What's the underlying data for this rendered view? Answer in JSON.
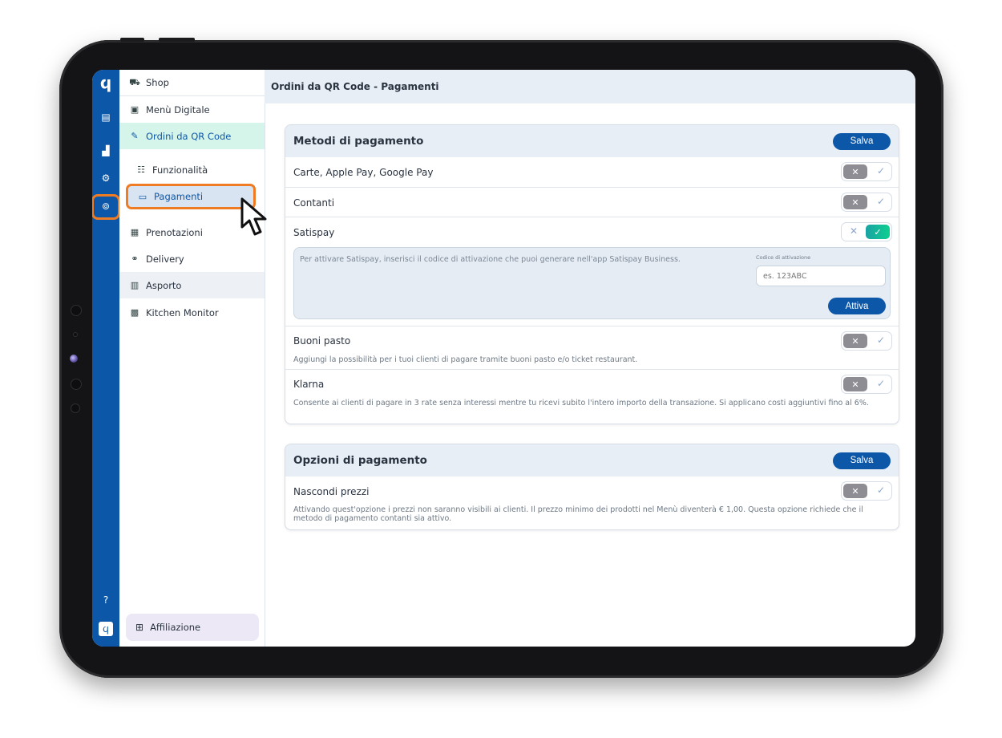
{
  "sidebar": {
    "items": [
      {
        "label": "Shop",
        "icon": "basket-icon"
      },
      {
        "label": "Menù Digitale",
        "icon": "menu-icon"
      },
      {
        "label": "Ordini da QR Code",
        "icon": "qr-order-icon"
      },
      {
        "label": "Funzionalità",
        "icon": "features-icon"
      },
      {
        "label": "Pagamenti",
        "icon": "card-icon"
      },
      {
        "label": "Prenotazioni",
        "icon": "calendar-icon"
      },
      {
        "label": "Delivery",
        "icon": "scooter-icon"
      },
      {
        "label": "Asporto",
        "icon": "bag-icon"
      },
      {
        "label": "Kitchen Monitor",
        "icon": "monitor-icon"
      }
    ],
    "affiliazione": "Affiliazione"
  },
  "header": {
    "title": "Ordini da QR Code - Pagamenti"
  },
  "metodi": {
    "title": "Metodi di pagamento",
    "save": "Salva",
    "carte": {
      "label": "Carte, Apple Pay, Google Pay",
      "enabled": false
    },
    "contanti": {
      "label": "Contanti",
      "enabled": false
    },
    "satispay": {
      "label": "Satispay",
      "enabled": true,
      "info": "Per attivare Satispay, inserisci il codice di attivazione che puoi generare nell'app Satispay Business.",
      "code_label": "Codice di attivazione",
      "code_placeholder": "es. 123ABC",
      "activate": "Attiva"
    },
    "buoni": {
      "label": "Buoni pasto",
      "enabled": false,
      "desc": "Aggiungi la possibilità per i tuoi clienti di pagare tramite buoni pasto e/o ticket restaurant."
    },
    "klarna": {
      "label": "Klarna",
      "enabled": false,
      "desc": "Consente ai clienti di pagare in 3 rate senza interessi mentre tu ricevi subito l'intero importo della transazione. Si applicano costi aggiuntivi fino al 6%."
    }
  },
  "opzioni": {
    "title": "Opzioni di pagamento",
    "save": "Salva",
    "nascondi": {
      "label": "Nascondi prezzi",
      "enabled": false,
      "desc": "Attivando quest'opzione i prezzi non saranno visibili ai clienti. Il prezzo minimo dei prodotti nel Menù diventerà € 1,00. Questa opzione richiede che il metodo di pagamento contanti sia attivo."
    }
  },
  "toggle": {
    "off": "✕",
    "on": "✓"
  },
  "colors": {
    "primary": "#0d57a8",
    "highlight": "#ef7b22",
    "toggle_on": "#12b89a"
  }
}
